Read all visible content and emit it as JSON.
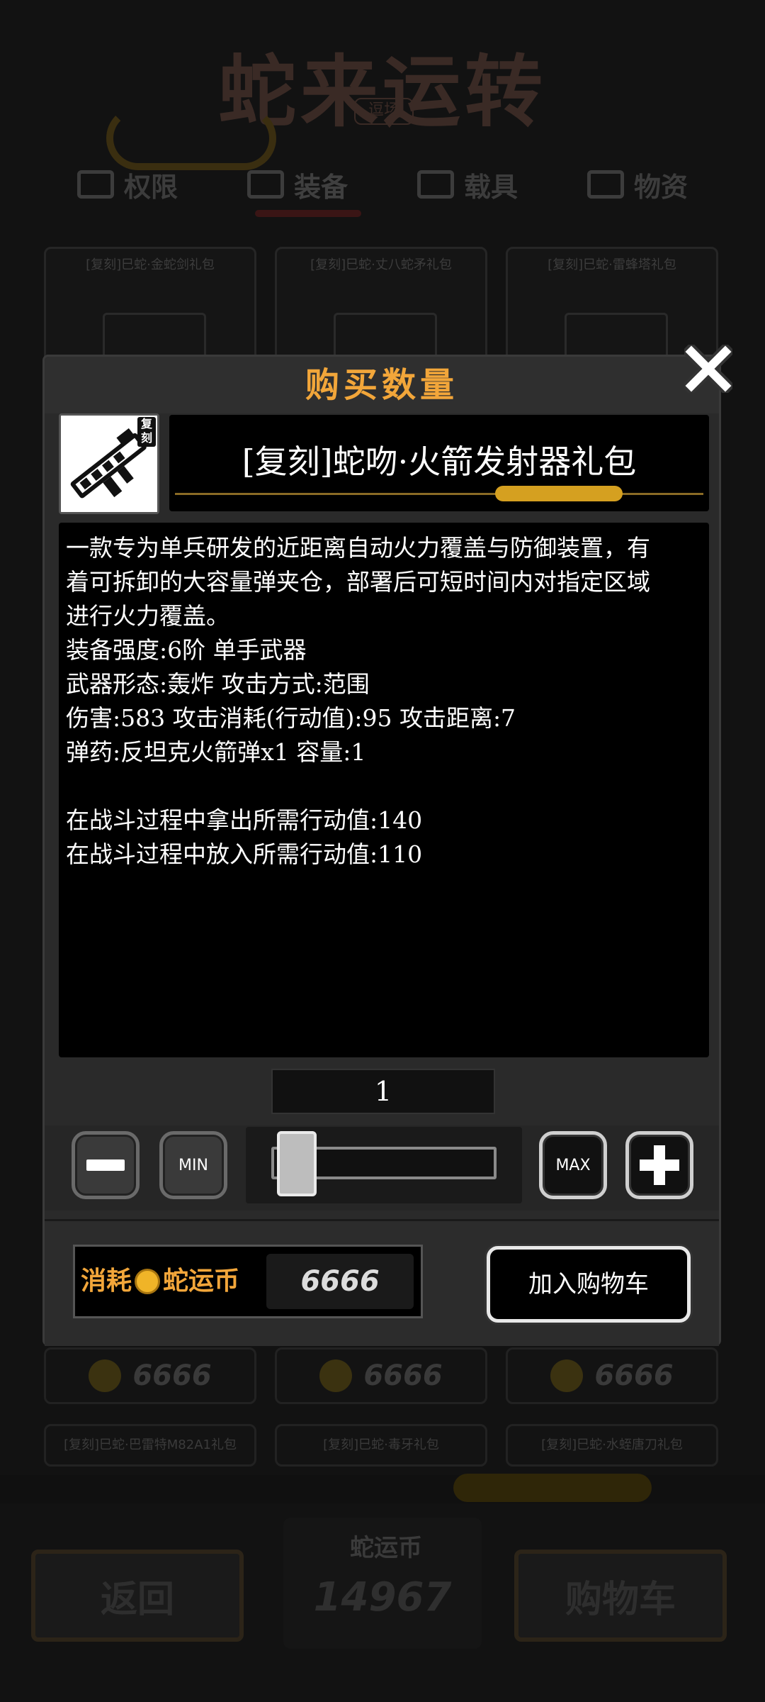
{
  "background": {
    "shop_title": "蛇来运转",
    "shop_subtitle": "逗场",
    "tabs": [
      {
        "label": "权限",
        "icon": "box-icon"
      },
      {
        "label": "装备",
        "icon": "shield-icon"
      },
      {
        "label": "载具",
        "icon": "car-icon"
      },
      {
        "label": "物资",
        "icon": "crate-icon"
      }
    ],
    "cards_top": [
      "[复刻]巳蛇·金蛇剑礼包",
      "[复刻]巳蛇·丈八蛇矛礼包",
      "[复刻]巳蛇·雷蜂塔礼包"
    ],
    "card_badge": "复刻",
    "card_prices": [
      "6666",
      "6666",
      "6666"
    ],
    "cards_bottom": [
      "[复刻]巳蛇·巴雷特M82A1礼包",
      "[复刻]巳蛇·毒牙礼包",
      "[复刻]巳蛇·水蛭唐刀礼包"
    ],
    "back_label": "返回",
    "balance_label": "蛇运币",
    "balance_value": "14967",
    "cart_label": "购物车"
  },
  "modal": {
    "title": "购买数量",
    "item_badge": "复刻",
    "item_name": "[复刻]蛇吻·火箭发射器礼包",
    "description_lines": [
      "一款专为单兵研发的近距离自动火力覆盖与防御装置，有",
      "着可拆卸的大容量弹夹仓，部署后可短时间内对指定区域",
      "进行火力覆盖。",
      "装备强度:6阶 单手武器",
      "武器形态:轰炸 攻击方式:范围",
      "伤害:583 攻击消耗(行动值):95 攻击距离:7",
      "弹药:反坦克火箭弹x1 容量:1",
      "",
      "在战斗过程中拿出所需行动值:140",
      "在战斗过程中放入所需行动值:110"
    ],
    "quantity": "1",
    "quantity_slider_fraction": 0,
    "min_label": "MIN",
    "max_label": "MAX",
    "cost_label_prefix": "消耗",
    "cost_currency": "蛇运币",
    "cost_value": "6666",
    "add_to_cart_label": "加入购物车"
  },
  "colors": {
    "accent_orange": "#f2a63a",
    "coin_gold": "#f0b428",
    "modal_bg": "#2a2a2a"
  }
}
